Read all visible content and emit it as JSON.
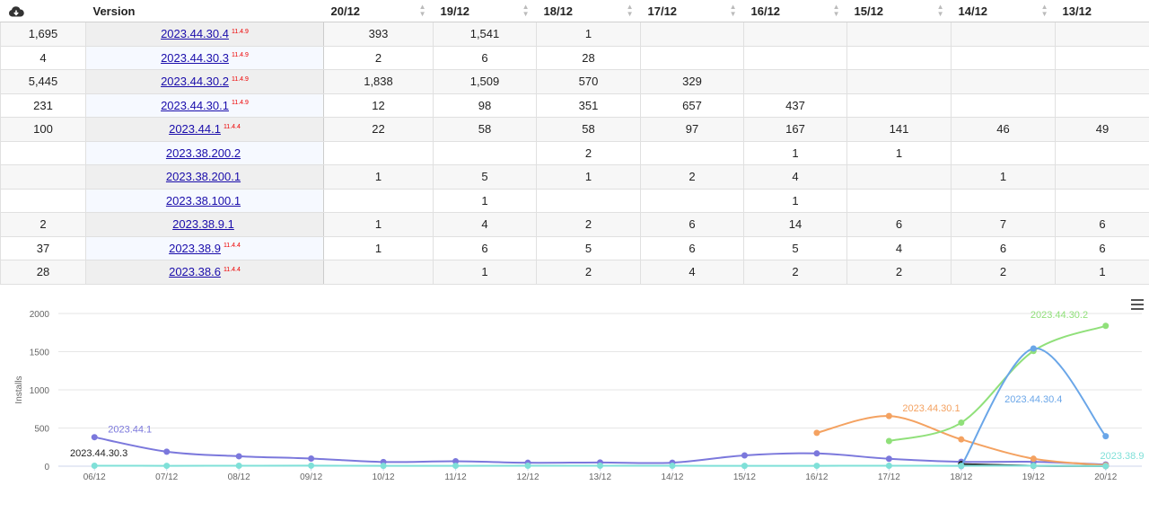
{
  "table": {
    "download_icon": "cloud-download-icon",
    "version_header": "Version",
    "date_headers": [
      "20/12",
      "19/12",
      "18/12",
      "17/12",
      "16/12",
      "15/12",
      "14/12",
      "13/12"
    ],
    "rows": [
      {
        "total": "1,695",
        "version": "2023.44.30.4",
        "badge": "11.4.9",
        "vals": [
          "393",
          "1,541",
          "1",
          "",
          "",
          "",
          "",
          ""
        ]
      },
      {
        "total": "4",
        "version": "2023.44.30.3",
        "badge": "11.4.9",
        "vals": [
          "2",
          "6",
          "28",
          "",
          "",
          "",
          "",
          ""
        ]
      },
      {
        "total": "5,445",
        "version": "2023.44.30.2",
        "badge": "11.4.9",
        "vals": [
          "1,838",
          "1,509",
          "570",
          "329",
          "",
          "",
          "",
          ""
        ]
      },
      {
        "total": "231",
        "version": "2023.44.30.1",
        "badge": "11.4.9",
        "vals": [
          "12",
          "98",
          "351",
          "657",
          "437",
          "",
          "",
          ""
        ]
      },
      {
        "total": "100",
        "version": "2023.44.1",
        "badge": "11.4.4",
        "vals": [
          "22",
          "58",
          "58",
          "97",
          "167",
          "141",
          "46",
          "49"
        ]
      },
      {
        "total": "",
        "version": "2023.38.200.2",
        "badge": "",
        "vals": [
          "",
          "",
          "2",
          "",
          "1",
          "1",
          "",
          ""
        ]
      },
      {
        "total": "",
        "version": "2023.38.200.1",
        "badge": "",
        "vals": [
          "1",
          "5",
          "1",
          "2",
          "4",
          "",
          "1",
          ""
        ]
      },
      {
        "total": "",
        "version": "2023.38.100.1",
        "badge": "",
        "vals": [
          "",
          "1",
          "",
          "",
          "1",
          "",
          "",
          ""
        ]
      },
      {
        "total": "2",
        "version": "2023.38.9.1",
        "badge": "",
        "vals": [
          "1",
          "4",
          "2",
          "6",
          "14",
          "6",
          "7",
          "6"
        ]
      },
      {
        "total": "37",
        "version": "2023.38.9",
        "badge": "11.4.4",
        "vals": [
          "1",
          "6",
          "5",
          "6",
          "5",
          "4",
          "6",
          "6"
        ]
      },
      {
        "total": "28",
        "version": "2023.38.6",
        "badge": "11.4.4",
        "vals": [
          "",
          "1",
          "2",
          "4",
          "2",
          "2",
          "2",
          "1"
        ]
      }
    ]
  },
  "chart_data": {
    "type": "line",
    "ylabel": "Installs",
    "xlabel": "",
    "ylim": [
      0,
      2000
    ],
    "yticks": [
      0,
      500,
      1000,
      1500,
      2000
    ],
    "categories": [
      "06/12",
      "07/12",
      "08/12",
      "09/12",
      "10/12",
      "11/12",
      "12/12",
      "13/12",
      "14/12",
      "15/12",
      "16/12",
      "17/12",
      "18/12",
      "19/12",
      "20/12"
    ],
    "series": [
      {
        "name": "2023.44.1",
        "color": "#7b78dc",
        "values": [
          380,
          190,
          130,
          100,
          55,
          65,
          45,
          49,
          46,
          141,
          167,
          97,
          58,
          58,
          22
        ],
        "label_at": 0,
        "label_pos": "right"
      },
      {
        "name": "2023.44.30.3",
        "color": "#222222",
        "values": [
          null,
          null,
          null,
          null,
          null,
          null,
          null,
          null,
          null,
          null,
          null,
          null,
          28,
          6,
          2
        ],
        "label_at": 0,
        "label_pos": "left-above"
      },
      {
        "name": "2023.44.30.1",
        "color": "#f4a261",
        "values": [
          null,
          null,
          null,
          null,
          null,
          null,
          null,
          null,
          null,
          null,
          437,
          657,
          351,
          98,
          12
        ],
        "label_at": 11,
        "label_pos": "right"
      },
      {
        "name": "2023.44.30.2",
        "color": "#90e07a",
        "values": [
          null,
          null,
          null,
          null,
          null,
          null,
          null,
          null,
          null,
          null,
          null,
          329,
          570,
          1509,
          1838
        ],
        "label_at": 13,
        "label_pos": "above"
      },
      {
        "name": "2023.44.30.4",
        "color": "#6aa6e8",
        "values": [
          null,
          null,
          null,
          null,
          null,
          null,
          null,
          null,
          null,
          null,
          null,
          null,
          1,
          1541,
          393
        ],
        "label_at": 13,
        "label_pos": "below"
      },
      {
        "name": "2023.38.9",
        "color": "#7fe0d8",
        "values": [
          6,
          5,
          6,
          7,
          4,
          5,
          6,
          6,
          6,
          4,
          5,
          6,
          5,
          6,
          1
        ],
        "label_at": 14,
        "label_pos": "above"
      }
    ]
  },
  "menu_icon": "hamburger-menu-icon"
}
